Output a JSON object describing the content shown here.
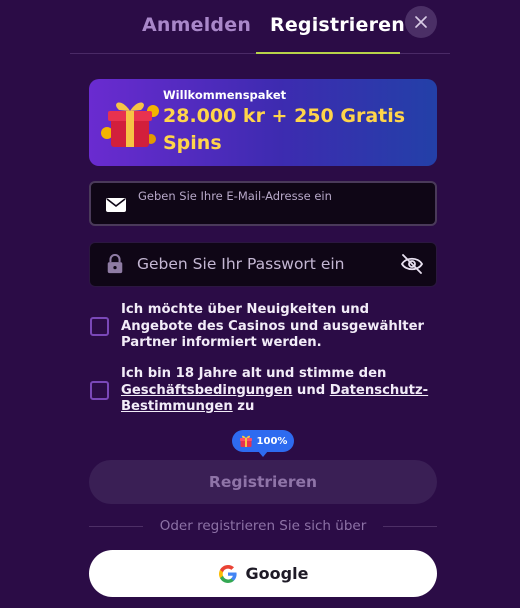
{
  "tabs": {
    "login_label": "Anmelden",
    "register_label": "Registrieren",
    "active": "register"
  },
  "close_icon": "close-icon",
  "banner": {
    "subtitle": "Willkommenspaket",
    "title": "28.000 kr + 250 Gratis Spins",
    "icon": "gift-icon"
  },
  "form": {
    "email": {
      "placeholder": "Geben Sie Ihre E-Mail-Adresse ein",
      "value": "",
      "icon": "envelope-icon"
    },
    "password": {
      "placeholder": "Geben Sie Ihr Passwort ein",
      "value": "",
      "icon": "lock-icon",
      "toggle_icon": "eye-off-icon"
    },
    "newsletter_consent": {
      "checked": false,
      "label": "Ich möchte über Neuigkeiten und Angebote des Casinos und ausgewählter Partner informiert werden."
    },
    "terms_consent": {
      "checked": false,
      "text_before": "Ich bin 18 Jahre alt und stimme den ",
      "terms_link": "Geschäftsbedingungen",
      "text_middle": " und ",
      "privacy_link": "Datenschutz-Bestimmungen",
      "text_after": " zu"
    }
  },
  "bonus_badge": {
    "icon": "gift-icon",
    "label": "100%"
  },
  "register_button": "Registrieren",
  "divider_text": "Oder registrieren Sie sich über",
  "google_button": {
    "icon": "google-icon",
    "label": "Google"
  },
  "colors": {
    "background": "#2b0c46",
    "accent_underline": "#b7d34a",
    "banner_title": "#ffd54a",
    "badge": "#2e6bf0"
  }
}
